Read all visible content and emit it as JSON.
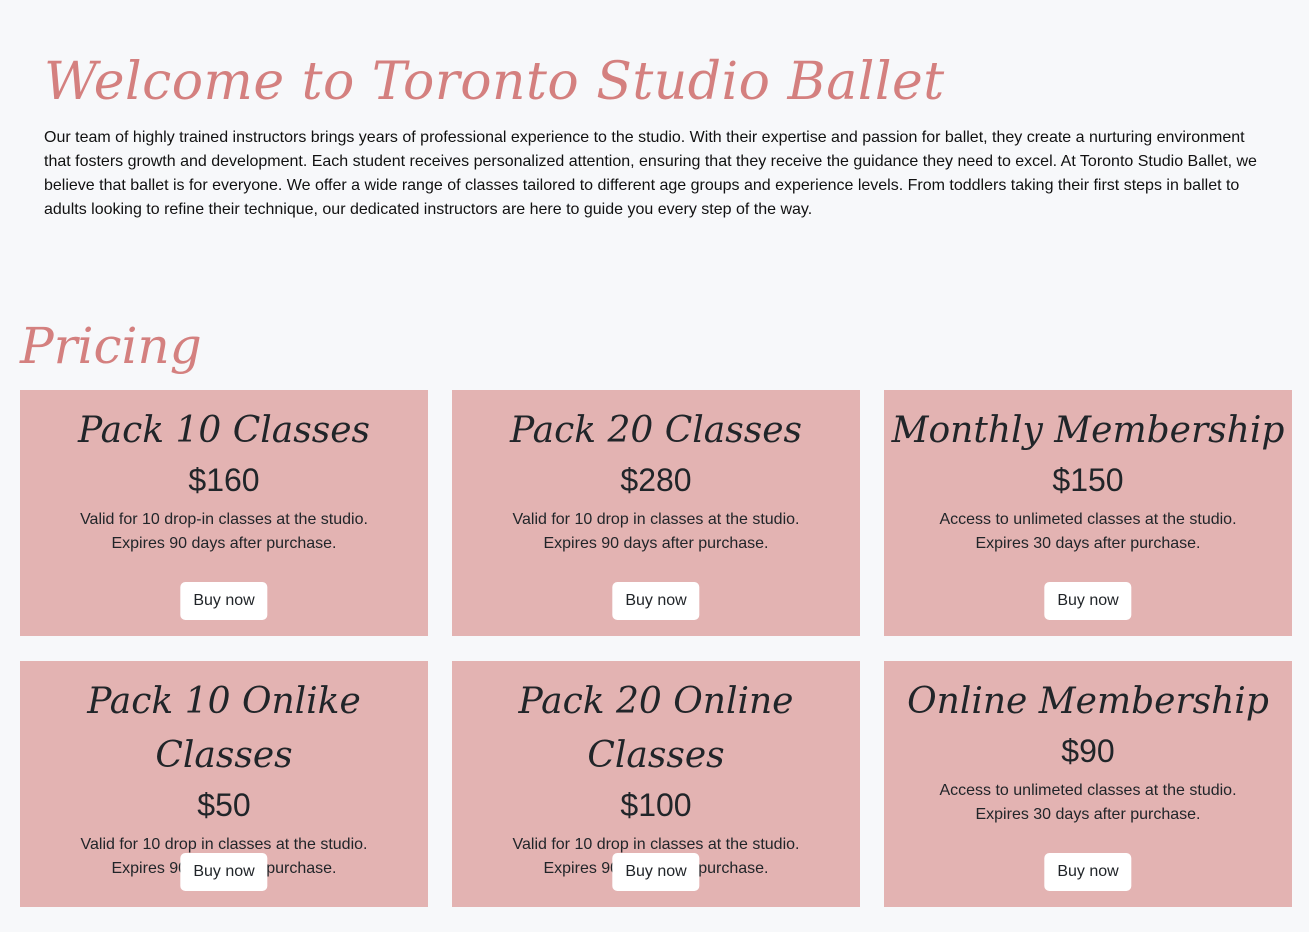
{
  "welcome": {
    "title": "Welcome to Toronto Studio Ballet",
    "text": "Our team of highly trained instructors brings years of professional experience to the studio. With their expertise and passion for ballet, they create a nurturing environment that fosters growth and development. Each student receives personalized attention, ensuring that they receive the guidance they need to excel. At Toronto Studio Ballet, we believe that ballet is for everyone. We offer a wide range of classes tailored to different age groups and experience levels. From toddlers taking their first steps in ballet to adults looking to refine their technique, our dedicated instructors are here to guide you every step of the way."
  },
  "pricing": {
    "title": "Pricing",
    "cards": [
      {
        "title": "Pack 10 Classes",
        "price": "$160",
        "line1": "Valid for 10 drop-in classes at the studio.",
        "line2": "Expires 90 days after purchase.",
        "button": "Buy now"
      },
      {
        "title": "Pack 20 Classes",
        "price": "$280",
        "line1": "Valid for 10 drop in classes at the studio.",
        "line2": "Expires 90 days after purchase.",
        "button": "Buy now"
      },
      {
        "title": "Monthly Membership",
        "price": "$150",
        "line1": "Access to unlimeted classes at the studio.",
        "line2": "Expires 30 days after purchase.",
        "button": "Buy now"
      },
      {
        "title": "Pack 10 Onlike Classes",
        "price": "$50",
        "line1": "Valid for 10 drop in classes at the studio.",
        "line2": "Expires 90 days after purchase.",
        "button": "Buy now"
      },
      {
        "title": "Pack 20 Online Classes",
        "price": "$100",
        "line1": "Valid for 10 drop in classes at the studio.",
        "line2": "Expires 90 days after purchase.",
        "button": "Buy now"
      },
      {
        "title": "Online Membership",
        "price": "$90",
        "line1": "Access to unlimeted classes at the studio.",
        "line2": "Expires 30 days after purchase.",
        "button": "Buy now"
      }
    ]
  },
  "colors": {
    "accent": "#d4807f",
    "card_background": "#e3b3b2",
    "page_background": "#f7f8fa",
    "button_background": "#ffffff"
  }
}
